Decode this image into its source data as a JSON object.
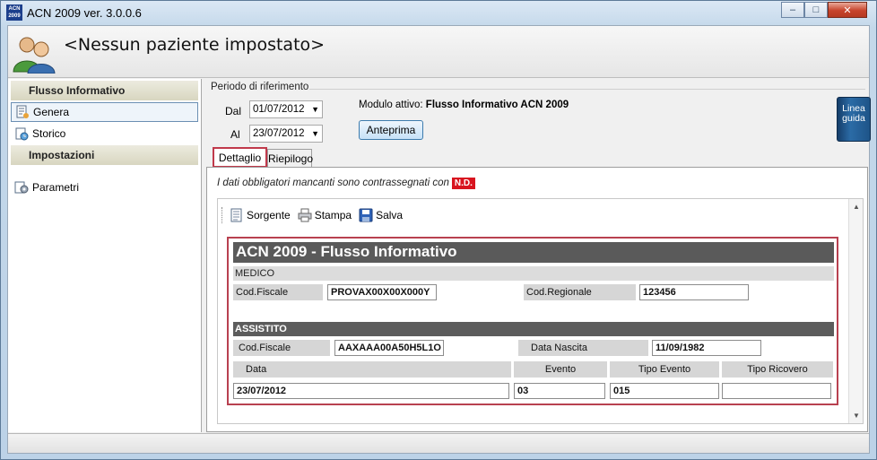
{
  "window": {
    "app_icon_text": "ACN 2009",
    "title": "ACN 2009  ver. 3.0.0.6",
    "buttons": {
      "minimize": "–",
      "maximize": "□",
      "close": "✕"
    }
  },
  "header": {
    "patient_title": "<Nessun paziente impostato>"
  },
  "sidebar": {
    "sections": [
      {
        "label": "Flusso Informativo",
        "items": [
          {
            "label": "Genera",
            "icon": "genera-icon",
            "selected": true
          },
          {
            "label": "Storico",
            "icon": "storico-icon"
          }
        ]
      },
      {
        "label": "Impostazioni",
        "items": [
          {
            "label": "Parametri",
            "icon": "parametri-icon"
          }
        ]
      }
    ]
  },
  "period": {
    "label": "Periodo di riferimento",
    "dal_label": "Dal",
    "dal_value": "01/07/2012",
    "al_label": "Al",
    "al_value": "23/07/2012"
  },
  "module": {
    "prefix": "Modulo attivo: ",
    "name": "Flusso Informativo ACN 2009",
    "preview_button": "Anteprima",
    "guide_label_1": "Linea",
    "guide_label_2": "guida"
  },
  "tabs": [
    {
      "label": "Dettaglio",
      "active": true
    },
    {
      "label": "Riepilogo",
      "active": false
    }
  ],
  "notice": {
    "text": "I dati obbligatori mancanti sono contrassegnati con",
    "badge": "N.D.",
    "badge_color": "#d8141f"
  },
  "toolbar": {
    "sorgente": "Sorgente",
    "stampa": "Stampa",
    "salva": "Salva"
  },
  "report": {
    "title": "ACN 2009 - Flusso Informativo",
    "medico": {
      "section": "MEDICO",
      "cf_label": "Cod.Fiscale",
      "cf_value": "PROVAX00X00X000Y",
      "reg_label": "Cod.Regionale",
      "reg_value": "123456"
    },
    "assistito": {
      "section": "ASSISTITO",
      "cf_label": "Cod.Fiscale",
      "cf_value": "AAXAAA00A50H5L1O",
      "birth_label": "Data Nascita",
      "birth_value": "11/09/1982",
      "columns": [
        "Data",
        "Evento",
        "Tipo Evento",
        "Tipo Ricovero"
      ],
      "row": [
        "23/07/2012",
        "03",
        "015",
        ""
      ]
    }
  },
  "colors": {
    "accent_red": "#c0394b",
    "section_dark": "#5c5c5c"
  }
}
